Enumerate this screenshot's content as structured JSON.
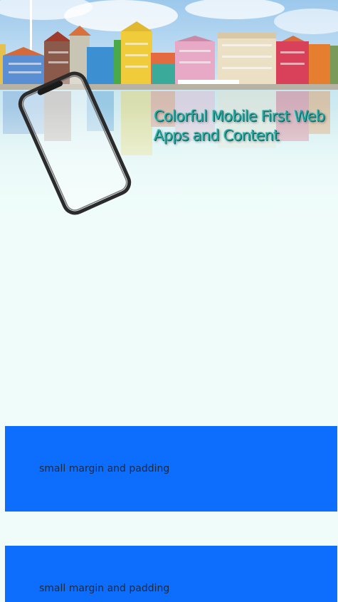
{
  "hero": {
    "title": "Colorful Mobile First Web Apps and Content",
    "background": "harbor-waterfront-photo",
    "device": "smartphone-outline"
  },
  "colors": {
    "page_background": "#effcfa",
    "box_background": "#0d6efd",
    "title_color": "#2aa6a0"
  },
  "boxes": [
    {
      "label": "small margin and padding"
    },
    {
      "label": "small margin and padding"
    }
  ]
}
